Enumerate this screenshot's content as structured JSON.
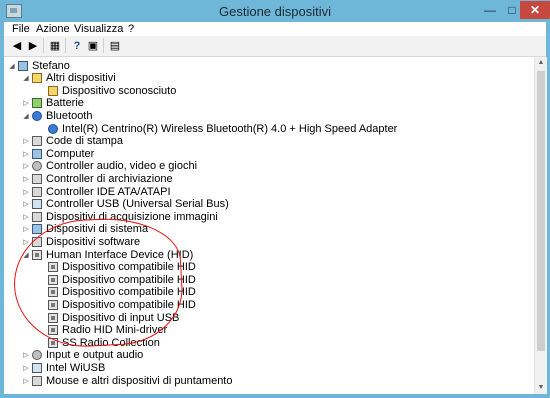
{
  "window": {
    "title": "Gestione dispositivi",
    "controls": {
      "minimize": "—",
      "maximize": "□",
      "close": "✕"
    }
  },
  "menu": [
    "File",
    "Azione",
    "Visualizza",
    "?"
  ],
  "toolbar": {
    "icons": [
      "back-icon",
      "forward-icon",
      "properties-icon",
      "help-icon",
      "show-hidden-icon",
      "scan-hardware-icon"
    ]
  },
  "tree": {
    "root": "Stefano",
    "nodes": [
      {
        "label": "Altri dispositivi",
        "expanded": true,
        "icon": "warning-icon",
        "children": [
          "Dispositivo sconosciuto"
        ]
      },
      {
        "label": "Batterie",
        "expanded": false,
        "icon": "battery-icon"
      },
      {
        "label": "Bluetooth",
        "expanded": true,
        "icon": "bluetooth-icon",
        "children": [
          "Intel(R) Centrino(R) Wireless Bluetooth(R) 4.0 + High Speed Adapter"
        ]
      },
      {
        "label": "Code di stampa",
        "expanded": false,
        "icon": "printer-icon"
      },
      {
        "label": "Computer",
        "expanded": false,
        "icon": "computer-icon"
      },
      {
        "label": "Controller audio, video e giochi",
        "expanded": false,
        "icon": "sound-icon"
      },
      {
        "label": "Controller di archiviazione",
        "expanded": false,
        "icon": "storage-icon"
      },
      {
        "label": "Controller IDE ATA/ATAPI",
        "expanded": false,
        "icon": "ide-icon"
      },
      {
        "label": "Controller USB (Universal Serial Bus)",
        "expanded": false,
        "icon": "usb-icon"
      },
      {
        "label": "Dispositivi di acquisizione immagini",
        "expanded": false,
        "icon": "camera-icon"
      },
      {
        "label": "Dispositivi di sistema",
        "expanded": false,
        "icon": "system-icon"
      },
      {
        "label": "Dispositivi software",
        "expanded": false,
        "icon": "software-icon"
      },
      {
        "label": "Human Interface Device (HID)",
        "expanded": true,
        "icon": "hid-icon",
        "children": [
          "Dispositivo compatibile HID",
          "Dispositivo compatibile HID",
          "Dispositivo compatibile HID",
          "Dispositivo compatibile HID",
          "Dispositivo di input USB",
          "Radio HID Mini-driver",
          "SS Radio Collection"
        ]
      },
      {
        "label": "Input e output audio",
        "expanded": false,
        "icon": "audio-io-icon"
      },
      {
        "label": "Intel WiUSB",
        "expanded": false,
        "icon": "wiusb-icon"
      },
      {
        "label": "Mouse e altri dispositivi di puntamento",
        "expanded": false,
        "icon": "mouse-icon"
      }
    ]
  },
  "annotation": {
    "color": "#e11111",
    "shape": "hand-drawn-circle"
  }
}
